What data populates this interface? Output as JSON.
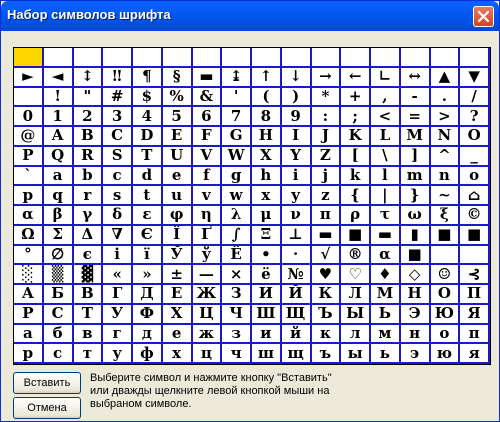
{
  "window": {
    "title": "Набор символов шрифта"
  },
  "buttons": {
    "insert_label": "Вставить",
    "cancel_label": "Отмена"
  },
  "hint": {
    "text": "Выберите символ и нажмите кнопку \"Вставить\" или  дважды щелкните левой кнопкой мыши на выбраном символе."
  },
  "selected_index": 0,
  "grid": {
    "rows": [
      [
        "",
        "",
        "",
        "",
        "",
        "",
        "",
        "",
        "",
        "",
        "",
        "",
        "",
        "",
        "",
        ""
      ],
      [
        "►",
        "◄",
        "↕",
        "‼",
        "¶",
        "§",
        "▬",
        "↨",
        "↑",
        "↓",
        "→",
        "←",
        "∟",
        "↔",
        "▲",
        "▼"
      ],
      [
        "",
        "!",
        "\"",
        "#",
        "$",
        "%",
        "&",
        "'",
        "(",
        ")",
        "*",
        "+",
        ",",
        "-",
        ".",
        "/"
      ],
      [
        "0",
        "1",
        "2",
        "3",
        "4",
        "5",
        "6",
        "7",
        "8",
        "9",
        ":",
        ";",
        "<",
        "=",
        ">",
        "?"
      ],
      [
        "@",
        "A",
        "B",
        "C",
        "D",
        "E",
        "F",
        "G",
        "H",
        "I",
        "J",
        "K",
        "L",
        "M",
        "N",
        "O"
      ],
      [
        "P",
        "Q",
        "R",
        "S",
        "T",
        "U",
        "V",
        "W",
        "X",
        "Y",
        "Z",
        "[",
        "\\",
        "]",
        "^",
        "_"
      ],
      [
        "`",
        "a",
        "b",
        "c",
        "d",
        "e",
        "f",
        "g",
        "h",
        "i",
        "j",
        "k",
        "l",
        "m",
        "n",
        "o"
      ],
      [
        "p",
        "q",
        "r",
        "s",
        "t",
        "u",
        "v",
        "w",
        "x",
        "y",
        "z",
        "{",
        "|",
        "}",
        "~",
        "⌂"
      ],
      [
        "α",
        "β",
        "γ",
        "δ",
        "ε",
        "φ",
        "η",
        "λ",
        "μ",
        "ν",
        "π",
        "ρ",
        "τ",
        "ω",
        "ξ",
        "©"
      ],
      [
        "Ω",
        "Σ",
        "Δ",
        "∇",
        "Є",
        "Ї",
        "Ґ",
        "∫",
        "Ξ",
        "⊥",
        "▬",
        "■",
        "▬",
        "▮",
        "■",
        "■"
      ],
      [
        "°",
        "∅",
        "є",
        "і",
        "ї",
        "Ў",
        "ў",
        "Ё",
        "•",
        "·",
        "√",
        "®",
        "α",
        "■",
        "",
        ""
      ],
      [
        "░",
        "▒",
        "▓",
        "«",
        "»",
        "±",
        "—",
        "×",
        "ё",
        "№",
        "♥",
        "♡",
        "♦",
        "◇",
        "☺",
        "⊰"
      ],
      [
        "А",
        "Б",
        "В",
        "Г",
        "Д",
        "Е",
        "Ж",
        "З",
        "И",
        "Й",
        "К",
        "Л",
        "М",
        "Н",
        "О",
        "П"
      ],
      [
        "Р",
        "С",
        "Т",
        "У",
        "Ф",
        "Х",
        "Ц",
        "Ч",
        "Ш",
        "Щ",
        "Ъ",
        "Ы",
        "Ь",
        "Э",
        "Ю",
        "Я"
      ],
      [
        "а",
        "б",
        "в",
        "г",
        "д",
        "е",
        "ж",
        "з",
        "и",
        "й",
        "к",
        "л",
        "м",
        "н",
        "о",
        "п"
      ],
      [
        "р",
        "с",
        "т",
        "у",
        "ф",
        "х",
        "ц",
        "ч",
        "ш",
        "щ",
        "ъ",
        "ы",
        "ь",
        "э",
        "ю",
        "я"
      ]
    ]
  }
}
